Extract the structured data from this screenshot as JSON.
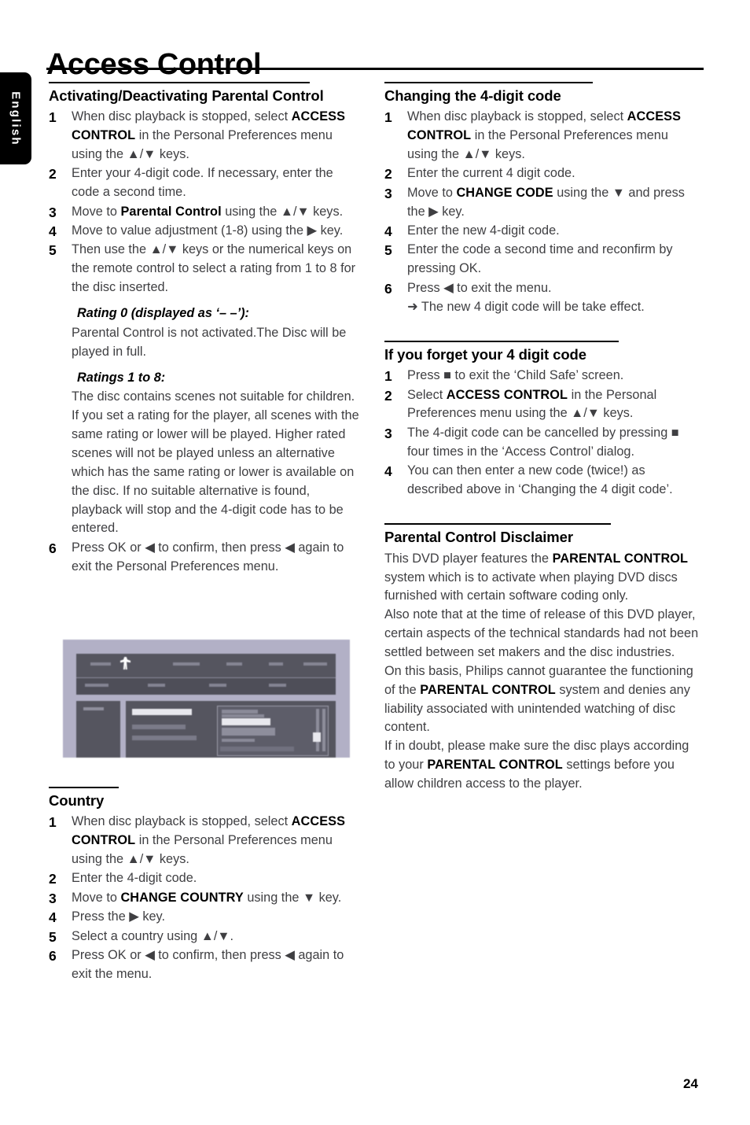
{
  "page": {
    "title": "Access Control",
    "language_tab": "English",
    "page_number": "24"
  },
  "left_column": {
    "sections": [
      {
        "heading": "Activating/Deactivating Parental Control",
        "steps": [
          {
            "num": "1",
            "html": "When disc playback is stopped, select <b>ACCESS CONTROL</b> in the Personal Preferences menu using the ▲/▼ keys."
          },
          {
            "num": "2",
            "html": "Enter your 4-digit code. If necessary, enter the code a second time."
          },
          {
            "num": "3",
            "html": "Move to <b>Parental Control</b> using the ▲/▼ keys."
          },
          {
            "num": "4",
            "html": "Move to value adjustment (1-8) using the ▶ key."
          },
          {
            "num": "5",
            "html": "Then use the ▲/▼ keys or the numerical keys on the remote control to select a rating from 1 to 8 for the disc inserted."
          }
        ],
        "notes": [
          {
            "title": "Rating 0 (displayed as ‘– –’):",
            "body": "Parental Control is not activated.The Disc will be played in full."
          },
          {
            "title": "Ratings 1 to 8:",
            "body": "The disc contains scenes not suitable for children. If you set a rating for the player, all scenes with the same rating or lower will be played. Higher rated scenes will not be played unless an alternative which has the same rating or lower is available on the disc. If no suitable alternative is found, playback will stop and the 4-digit code has to be entered."
          }
        ],
        "final_step": {
          "num": "6",
          "html": "Press OK or ◀ to confirm, then press ◀ again to exit the Personal Preferences menu."
        }
      },
      {
        "heading": "Country",
        "steps": [
          {
            "num": "1",
            "html": "When disc playback is stopped, select <b>ACCESS CONTROL</b> in the Personal Preferences menu using the ▲/▼ keys."
          },
          {
            "num": "2",
            "html": "Enter the 4-digit code."
          },
          {
            "num": "3",
            "html": "Move to <b>CHANGE COUNTRY</b> using the ▼ key."
          },
          {
            "num": "4",
            "html": "Press the ▶ key."
          },
          {
            "num": "5",
            "html": "Select a country using ▲/▼."
          },
          {
            "num": "6",
            "html": "Press OK or ◀ to confirm, then press ◀ again to exit the menu."
          }
        ]
      }
    ],
    "figure": {
      "caption": "",
      "alt": "Blurred on-screen display of the DVD player Access Control menu showing the Parental level dialog",
      "visible_labels": [
        "Access control",
        "Parental level"
      ]
    }
  },
  "right_column": {
    "sections": [
      {
        "heading": "Changing the 4-digit code",
        "steps": [
          {
            "num": "1",
            "html": "When disc playback is stopped, select <b>ACCESS CONTROL</b> in the Personal Preferences menu using the ▲/▼ keys."
          },
          {
            "num": "2",
            "html": "Enter the current 4 digit code."
          },
          {
            "num": "3",
            "html": "Move to <b>CHANGE CODE</b> using the ▼ and press the ▶ key."
          },
          {
            "num": "4",
            "html": "Enter the new 4-digit code."
          },
          {
            "num": "5",
            "html": "Enter the code a second time and reconfirm by pressing OK."
          },
          {
            "num": "6",
            "html": "Press ◀ to exit the menu."
          }
        ],
        "substep": "➜ The new 4 digit code will be take effect."
      },
      {
        "heading": "If you forget your 4 digit code",
        "steps": [
          {
            "num": "1",
            "html": "Press ■ to exit the ‘Child Safe’ screen."
          },
          {
            "num": "2",
            "html": "Select <b>ACCESS CONTROL</b> in the Personal Preferences menu  using the ▲/▼ keys."
          },
          {
            "num": "3",
            "html": "The 4-digit code can be cancelled by pressing ■ four times in the ‘Access Control’ dialog."
          },
          {
            "num": "4",
            "html": "You can then enter a new code (twice!) as described above in ‘Changing the 4 digit code’."
          }
        ]
      },
      {
        "heading": "Parental Control Disclaimer",
        "paragraphs": [
          "This DVD player features the <b>PARENTAL CONTROL</b> system which is to activate when playing DVD discs furnished with certain software coding only.",
          "Also note that at the time of release of this DVD player, certain aspects of the technical standards had not been settled between set makers and the disc industries.",
          "On this basis, Philips cannot guarantee the functioning of the <b>PARENTAL CONTROL</b> system and denies any liability associated with unintended watching of disc content.",
          "If in doubt, please make sure the disc plays according to your <b>PARENTAL CONTROL</b> settings before you allow children access to the player."
        ]
      }
    ]
  },
  "colors": {
    "text": "#3f3f42",
    "heading": "#000000",
    "tab_background": "#000000",
    "tab_text": "#ffffff",
    "figure_border": "#b2b0c6",
    "figure_panel": "#55555f"
  }
}
